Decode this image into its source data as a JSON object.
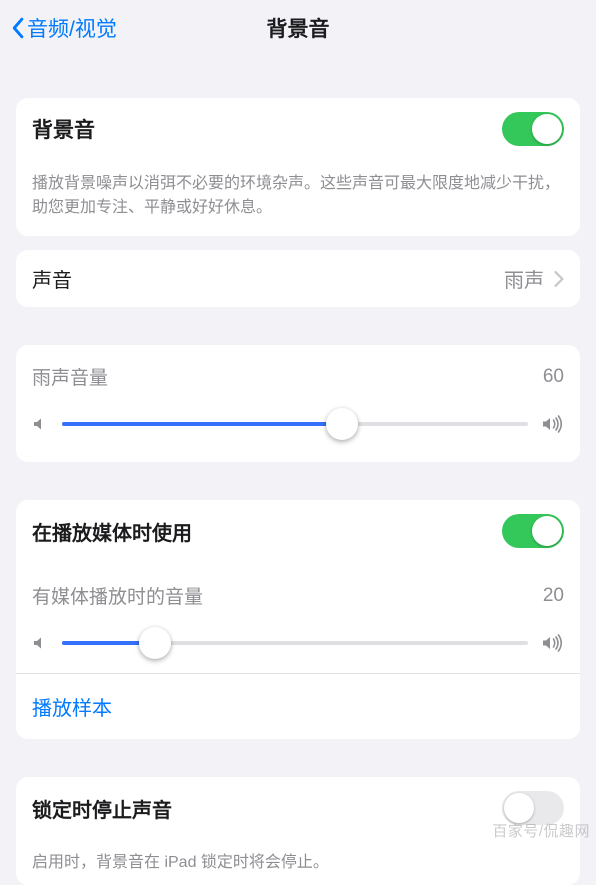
{
  "nav": {
    "back": "音频/视觉",
    "title": "背景音"
  },
  "main_toggle": {
    "label": "背景音",
    "on": true
  },
  "main_footer": "播放背景噪声以消弭不必要的环境杂声。这些声音可最大限度地减少干扰，助您更加专注、平静或好好休息。",
  "sound": {
    "label": "声音",
    "value": "雨声"
  },
  "slider1": {
    "label": "雨声音量",
    "value": 60,
    "value_text": "60"
  },
  "media": {
    "toggle_label": "在播放媒体时使用",
    "toggle_on": true,
    "slider_label": "有媒体播放时的音量",
    "slider_value": 20,
    "slider_value_text": "20",
    "link": "播放样本"
  },
  "lock": {
    "label": "锁定时停止声音",
    "on": false,
    "footer": "启用时，背景音在 iPad 锁定时将会停止。"
  },
  "watermark": "百家号/侃趣网"
}
